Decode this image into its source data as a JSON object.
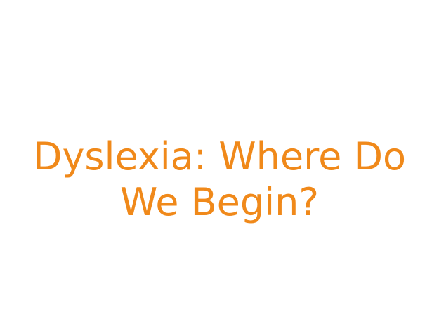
{
  "slide": {
    "title_line_1": "Dyslexia: Where Do",
    "title_line_2": "We Begin?",
    "title_color": "#F0891A",
    "background_color": "#FFFFFF"
  }
}
